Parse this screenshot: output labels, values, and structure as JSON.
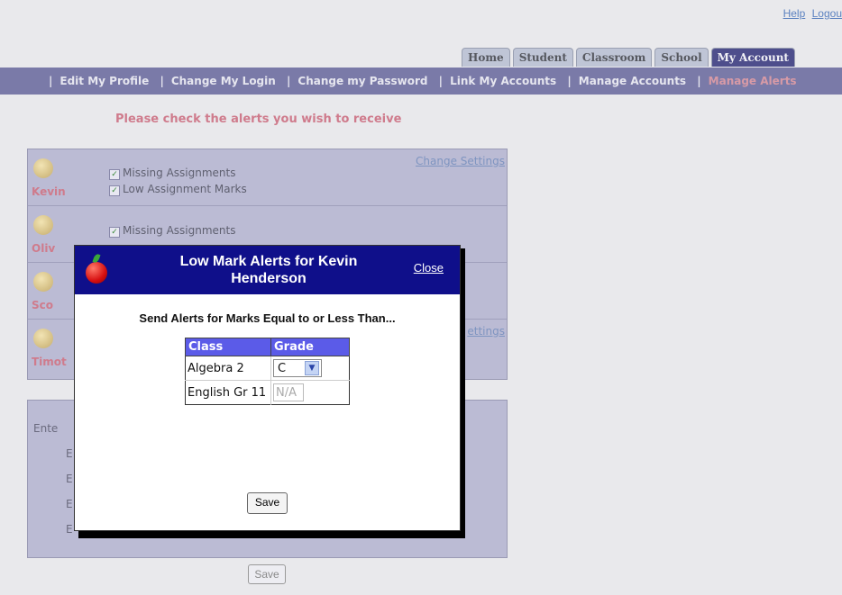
{
  "toplinks": {
    "help": "Help",
    "logout": "Logou"
  },
  "tabs": [
    "Home",
    "Student",
    "Classroom",
    "School",
    "My Account"
  ],
  "subnav": [
    "Edit My Profile",
    "Change My Login",
    "Change my Password",
    "Link My Accounts",
    "Manage Accounts",
    "Manage Alerts"
  ],
  "page": {
    "heading": "Please check the alerts you wish to receive",
    "change_settings": "Change Settings",
    "students": [
      {
        "name": "Kevin",
        "alerts": [
          "Missing Assignments",
          "Low Assignment Marks"
        ]
      },
      {
        "name": "Oliv",
        "alerts": [
          "Missing Assignments"
        ]
      },
      {
        "name": "Sco",
        "alerts": []
      },
      {
        "name": "Timot",
        "alerts": []
      }
    ],
    "change_settings_partial": "ettings",
    "enter_label": "Ente",
    "e_lines": [
      "E",
      "E",
      "E",
      "E"
    ],
    "save": "Save"
  },
  "modal": {
    "title": "Low Mark Alerts for Kevin Henderson",
    "close": "Close",
    "prompt": "Send Alerts for Marks Equal to or Less Than...",
    "table": {
      "headers": [
        "Class",
        "Grade"
      ],
      "rows": [
        {
          "class": "Algebra 2",
          "grade": "C"
        },
        {
          "class": "English Gr 11",
          "grade": "N/A"
        }
      ]
    },
    "save": "Save"
  },
  "icons": {
    "apple": "apple-icon",
    "student_avatar": "student-avatar-icon",
    "dropdown": "chevron-down-icon",
    "checkbox": "checkbox-checked-icon"
  }
}
